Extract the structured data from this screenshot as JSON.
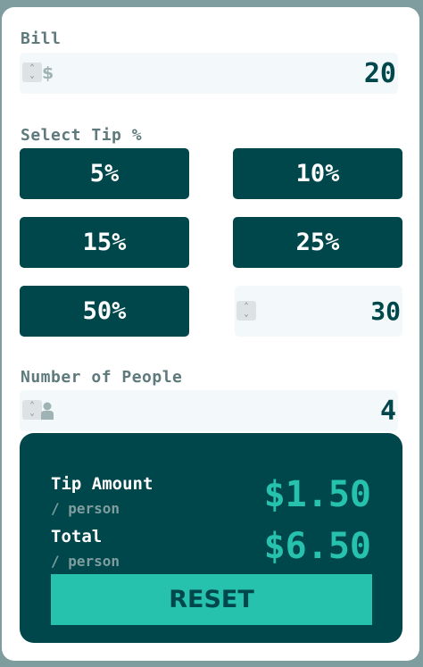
{
  "bill": {
    "label": "Bill",
    "currency_icon": "$",
    "value": "20"
  },
  "tip": {
    "label": "Select Tip %",
    "options": [
      "5%",
      "10%",
      "15%",
      "25%",
      "50%"
    ],
    "custom_value": "30"
  },
  "people": {
    "label": "Number of People",
    "person_icon": "person-icon",
    "value": "4"
  },
  "results": {
    "tip_amount_label": "Tip Amount",
    "tip_amount_sub": "/ person",
    "tip_amount_value": "$1.50",
    "total_label": "Total",
    "total_sub": "/ person",
    "total_value": "$6.50",
    "reset_label": "RESET"
  },
  "colors": {
    "dark_cyan": "#00474b",
    "strong_cyan": "#26c2ae",
    "grayish_cyan": "#5e7a7d",
    "light_bg": "#f3f9fa"
  }
}
